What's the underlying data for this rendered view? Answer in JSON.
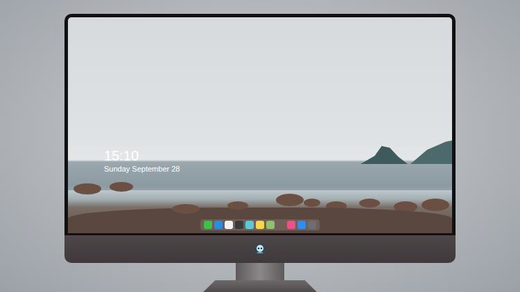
{
  "lock_screen": {
    "time": "15:10",
    "date": "Sunday September 28"
  },
  "dock": {
    "items": [
      {
        "color": "#3cc14a"
      },
      {
        "color": "#2a8de0"
      },
      {
        "color": "#f2f2f2"
      },
      {
        "color": "#3a3a3c"
      },
      {
        "color": "#5bc8d8"
      },
      {
        "color": "#f7d64a"
      },
      {
        "color": "#8fc26a"
      },
      {
        "color": "#f0508a"
      },
      {
        "color": "#2f8cf0"
      },
      {
        "color": "#6e6e72"
      }
    ]
  }
}
